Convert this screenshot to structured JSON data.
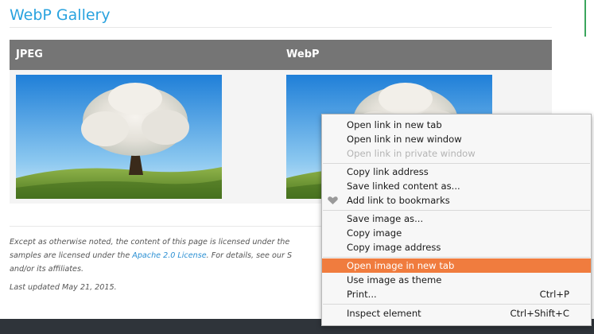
{
  "page": {
    "title": "WebP Gallery",
    "table": {
      "headers": [
        "JPEG",
        "WebP"
      ]
    },
    "footer": {
      "text_1": "Except as otherwise noted, the content of this page is licensed under the",
      "text_2": "samples are licensed under the ",
      "link_apache": "Apache 2.0 License",
      "text_3": ". For details, see our S",
      "text_4": "and/or its affiliates.",
      "last_updated": "Last updated May 21, 2015."
    }
  },
  "context_menu": {
    "items": [
      {
        "label": "Open link in new tab"
      },
      {
        "label": "Open link in new window"
      },
      {
        "label": "Open link in private window",
        "disabled": true
      },
      {
        "label": "Copy link address"
      },
      {
        "label": "Save linked content as..."
      },
      {
        "label": "Add link to bookmarks",
        "icon": "heart-icon"
      },
      {
        "label": "Save image as..."
      },
      {
        "label": "Copy image"
      },
      {
        "label": "Copy image address"
      },
      {
        "label": "Open image in new tab",
        "highlighted": true
      },
      {
        "label": "Use image as theme"
      },
      {
        "label": "Print...",
        "shortcut": "Ctrl+P"
      },
      {
        "label": "Inspect element",
        "shortcut": "Ctrl+Shift+C"
      }
    ]
  },
  "colors": {
    "title": "#2aa3df",
    "header_bg": "#757575",
    "highlight": "#f07c3e",
    "link": "#2a8fd3"
  }
}
